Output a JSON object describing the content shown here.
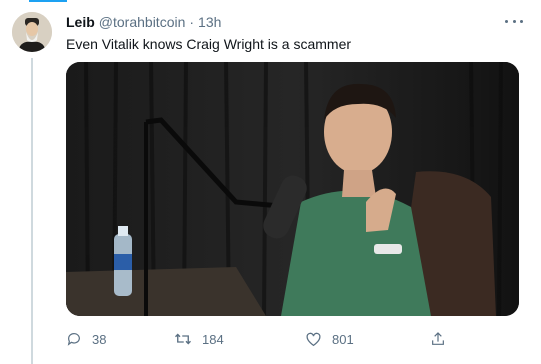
{
  "tweet": {
    "author_name": "Leib",
    "handle": "@torahbitcoin",
    "separator": "·",
    "time": "13h",
    "text": "Even Vitalik knows Craig Wright is a scammer",
    "media_icon": "video-still-image",
    "more_icon": "more-horizontal-icon"
  },
  "actions": {
    "reply_count": "38",
    "retweet_count": "184",
    "like_count": "801",
    "icons": [
      "reply-icon",
      "retweet-icon",
      "like-icon",
      "share-icon"
    ]
  },
  "colors": {
    "accent": "#1da1f2",
    "text_primary": "#0f1419",
    "text_secondary": "#5b7083",
    "thread_line": "#cfd9de"
  }
}
